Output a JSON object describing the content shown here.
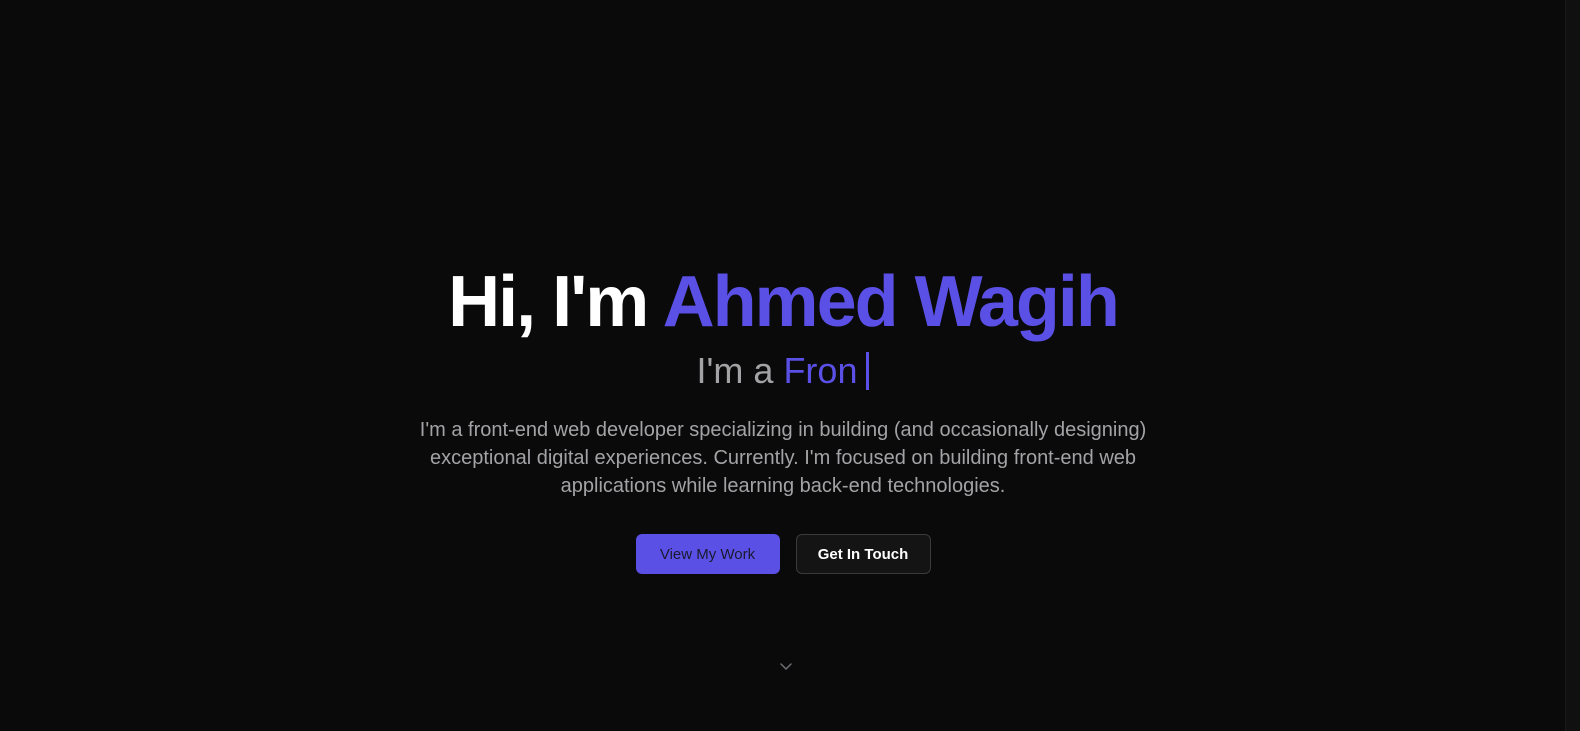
{
  "hero": {
    "greeting": "Hi, I'm",
    "name": "Ahmed Wagih",
    "subtitle_prefix": "I'm a",
    "typed_role": "Fron",
    "description": "I'm a front-end web developer specializing in building (and occasionally designing) exceptional digital experiences. Currently. I'm focused on building front-end web applications while learning back-end technologies."
  },
  "actions": {
    "primary_label": "View My Work",
    "secondary_label": "Get In Touch"
  },
  "scroll_indicator": {
    "icon": "chevron-down-icon"
  },
  "colors": {
    "background": "#0a0a0b",
    "accent": "#5b50e6",
    "heading": "#ffffff",
    "muted_text": "#a3a3a6"
  }
}
